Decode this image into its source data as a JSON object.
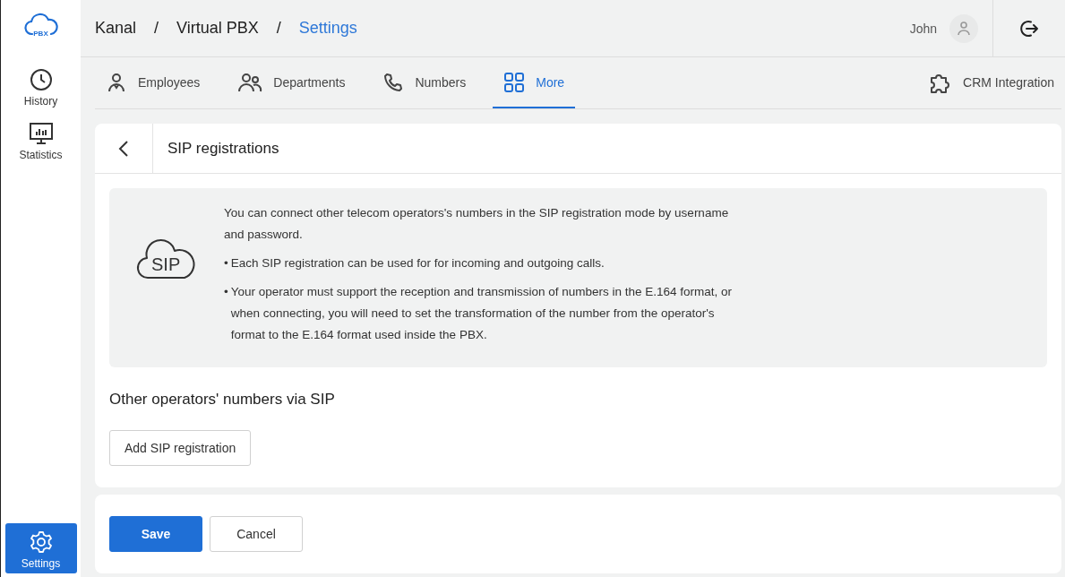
{
  "sidebar": {
    "logo_text": "PBX",
    "items": [
      {
        "label": "History",
        "kind": "clock",
        "selected": false
      },
      {
        "label": "Statistics",
        "kind": "chart",
        "selected": false
      }
    ],
    "bottom_item": {
      "label": "Settings",
      "kind": "gear",
      "selected": true
    }
  },
  "breadcrumbs": [
    {
      "label": "Kanal",
      "current": false
    },
    {
      "label": "Virtual PBX",
      "current": false
    },
    {
      "label": "Settings",
      "current": true
    }
  ],
  "breadcrumb_separator": "/",
  "user": {
    "name": "John"
  },
  "tabs": [
    {
      "label": "Employees",
      "kind": "person",
      "selected": false
    },
    {
      "label": "Departments",
      "kind": "people",
      "selected": false
    },
    {
      "label": "Numbers",
      "kind": "phone",
      "selected": false
    },
    {
      "label": "More",
      "kind": "grid",
      "selected": true
    }
  ],
  "extra_tab": {
    "label": "CRM Integration",
    "kind": "puzzle",
    "selected": false
  },
  "panel": {
    "title": "SIP registrations",
    "info": {
      "icon_text": "SIP",
      "intro": "You can connect other telecom operators's numbers in the SIP registration mode by username and password.",
      "bullets": [
        {
          "marker": "•",
          "text": "Each SIP registration can be used for for incoming and outgoing calls."
        },
        {
          "marker": "•",
          "text": "Your operator must support the reception and transmission of numbers in the E.164 format, or when connecting, you will need to set the transformation of the number from the operator's format to the E.164 format used inside the PBX."
        }
      ]
    },
    "section_title": "Other operators' numbers via SIP",
    "add_button": "Add SIP registration"
  },
  "footer_buttons": [
    {
      "label": "Save",
      "kind": "primary"
    },
    {
      "label": "Cancel",
      "kind": "secondary"
    }
  ]
}
